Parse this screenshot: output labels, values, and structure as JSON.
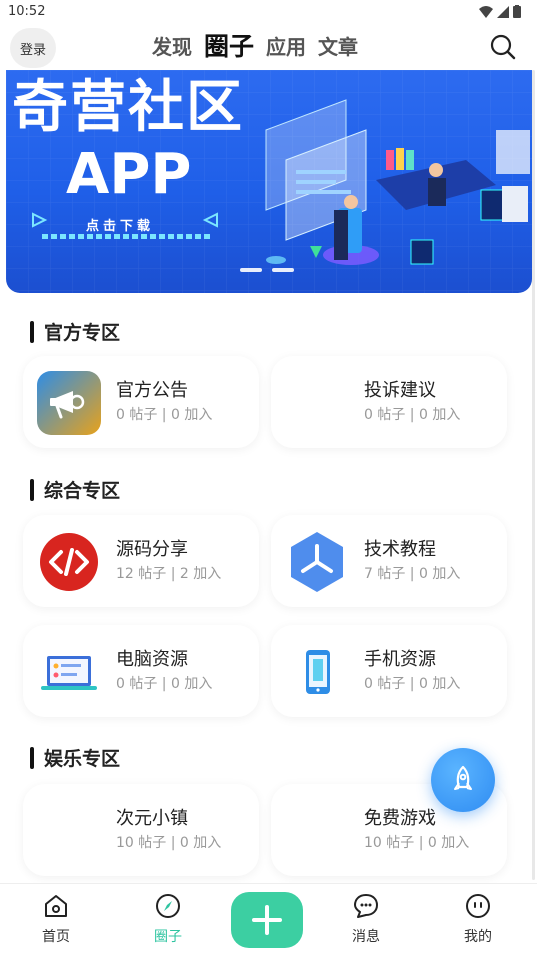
{
  "status": {
    "time": "10:52"
  },
  "header": {
    "login_label": "登录",
    "tabs": [
      {
        "label": "发现"
      },
      {
        "label": "圈子"
      },
      {
        "label": "应用"
      },
      {
        "label": "文章"
      }
    ]
  },
  "banner": {
    "title": "奇营社区",
    "subtitle": "APP",
    "cta": "点击下载"
  },
  "sections": [
    {
      "title": "官方专区",
      "cards": [
        {
          "name": "官方公告",
          "meta": "0 帖子 | 0 加入",
          "icon": "megaphone-icon"
        },
        {
          "name": "投诉建议",
          "meta": "0 帖子 | 0 加入",
          "icon": ""
        }
      ]
    },
    {
      "title": "综合专区",
      "cards": [
        {
          "name": "源码分享",
          "meta": "12 帖子 | 2 加入",
          "icon": "code-icon"
        },
        {
          "name": "技术教程",
          "meta": "7 帖子 | 0 加入",
          "icon": "hexagon-icon"
        },
        {
          "name": "电脑资源",
          "meta": "0 帖子 | 0 加入",
          "icon": "laptop-icon"
        },
        {
          "name": "手机资源",
          "meta": "0 帖子 | 0 加入",
          "icon": "phone-icon"
        }
      ]
    },
    {
      "title": "娱乐专区",
      "cards": [
        {
          "name": "次元小镇",
          "meta": "10 帖子 | 0 加入",
          "icon": ""
        },
        {
          "name": "免费游戏",
          "meta": "10 帖子 | 0 加入",
          "icon": ""
        }
      ]
    }
  ],
  "nav": {
    "items": [
      {
        "label": "首页",
        "icon": "home-icon"
      },
      {
        "label": "圈子",
        "icon": "compass-icon"
      },
      {
        "label": "消息",
        "icon": "chat-icon"
      },
      {
        "label": "我的",
        "icon": "profile-icon"
      }
    ]
  },
  "colors": {
    "accent": "#2ec4a0",
    "banner": "#2466ee",
    "fab": "#2f8cf2"
  }
}
